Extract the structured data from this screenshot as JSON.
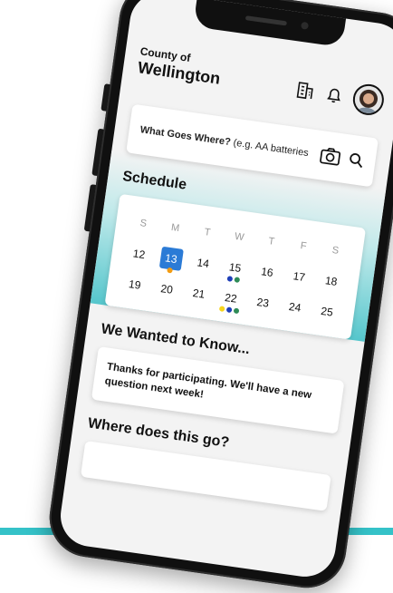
{
  "header": {
    "title_small": "County of",
    "title_big": "Wellington"
  },
  "search": {
    "label_bold": "What Goes Where?",
    "hint": " (e.g. AA batteries"
  },
  "schedule": {
    "title": "Schedule",
    "weekdays": [
      "S",
      "M",
      "T",
      "W",
      "T",
      "F",
      "S"
    ],
    "weeks": [
      [
        {
          "day": "12",
          "dots": []
        },
        {
          "day": "13",
          "selected": true,
          "dots": [
            "#f39c12"
          ]
        },
        {
          "day": "14",
          "dots": []
        },
        {
          "day": "15",
          "dots": [
            "#1f3fb8",
            "#2e8b57"
          ]
        },
        {
          "day": "16",
          "dots": []
        },
        {
          "day": "17",
          "dots": []
        },
        {
          "day": "18",
          "dots": []
        }
      ],
      [
        {
          "day": "19",
          "dots": []
        },
        {
          "day": "20",
          "dots": []
        },
        {
          "day": "21",
          "dots": []
        },
        {
          "day": "22",
          "dots": [
            "#f7d51d",
            "#1f3fb8",
            "#2e8b57"
          ]
        },
        {
          "day": "23",
          "dots": []
        },
        {
          "day": "24",
          "dots": []
        },
        {
          "day": "25",
          "dots": []
        }
      ]
    ]
  },
  "know": {
    "title": "We Wanted to Know...",
    "message": "Thanks for participating. We'll have a new question next week!"
  },
  "where": {
    "title": "Where does this go?"
  },
  "colors": {
    "accent": "#2b7bd6",
    "teal": "#35c2c8"
  }
}
